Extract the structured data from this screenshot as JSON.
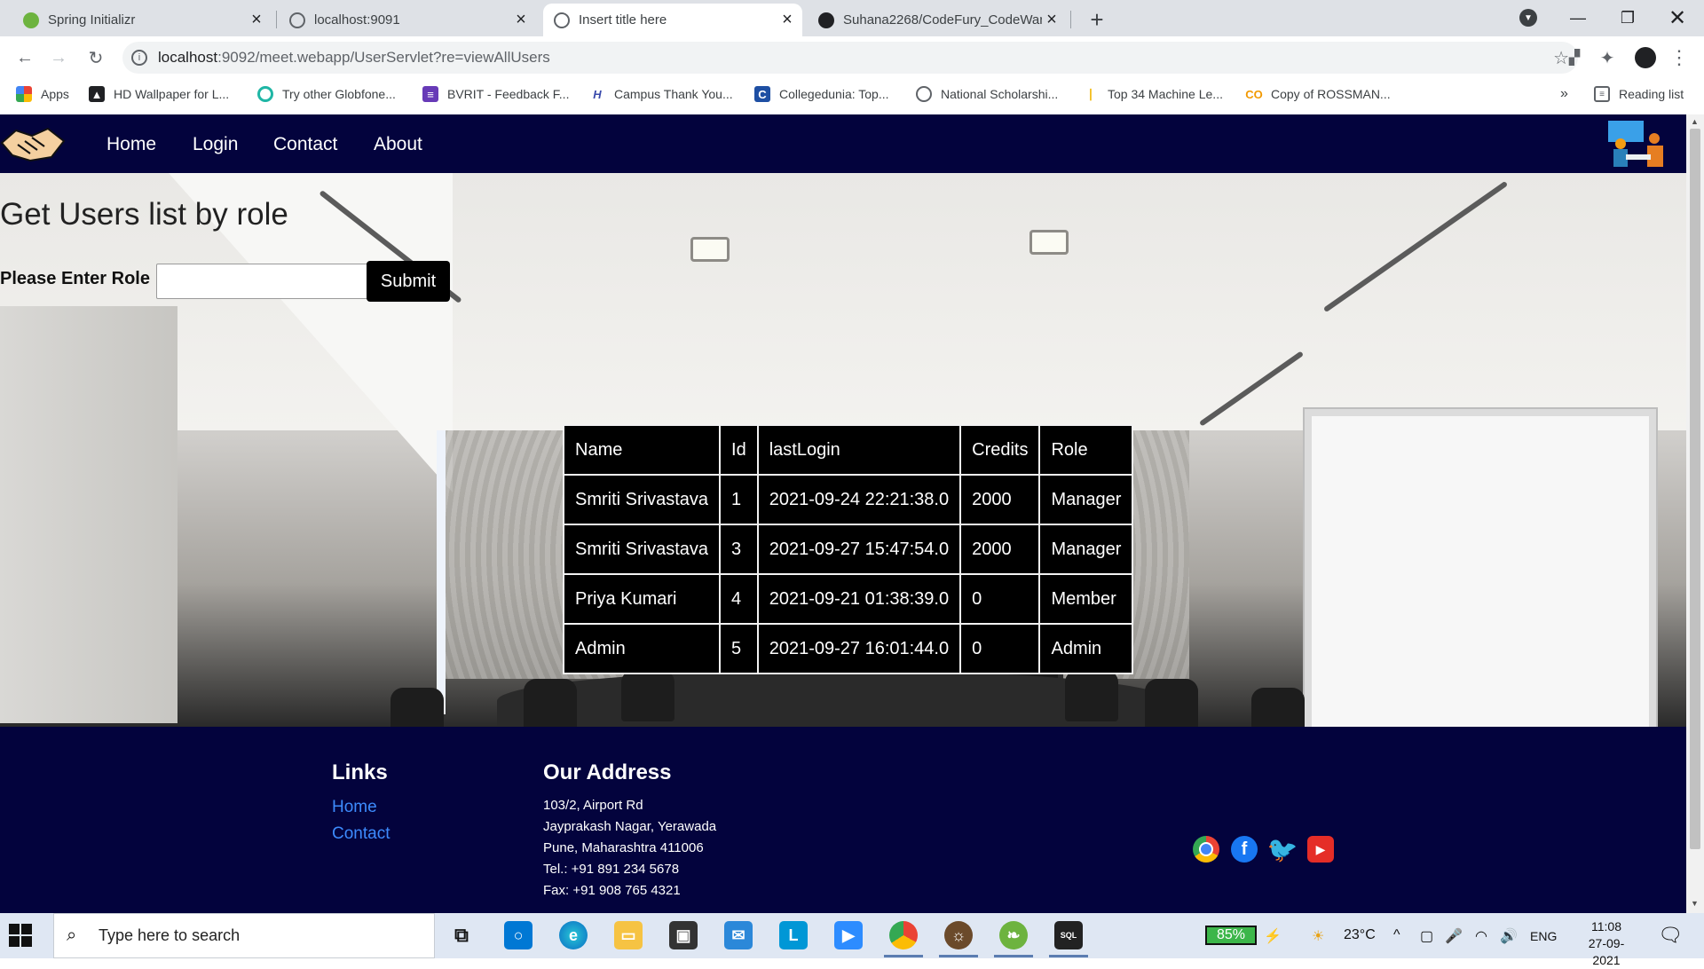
{
  "browser": {
    "tabs": [
      {
        "title": "Spring Initializr",
        "favicon_color": "#6db33f",
        "active": false
      },
      {
        "title": "localhost:9091",
        "favicon_color": "#5f6368",
        "active": false
      },
      {
        "title": "Insert title here",
        "favicon_color": "#5f6368",
        "active": true
      },
      {
        "title": "Suhana2268/CodeFury_CodeWar",
        "favicon_color": "#202124",
        "active": false
      }
    ],
    "new_tab": "+",
    "address": {
      "host": "localhost",
      "rest": ":9092/meet.webapp/UserServlet?re=viewAllUsers"
    },
    "bookmarks": [
      {
        "label": "Apps"
      },
      {
        "label": "HD Wallpaper for L..."
      },
      {
        "label": "Try other Globfone..."
      },
      {
        "label": "BVRIT - Feedback F..."
      },
      {
        "label": "Campus Thank You..."
      },
      {
        "label": "Collegedunia: Top..."
      },
      {
        "label": "National Scholarshi..."
      },
      {
        "label": "Top 34 Machine Le..."
      },
      {
        "label": "Copy of ROSSMAN..."
      }
    ],
    "bookmarks_overflow": "»",
    "reading_list": "Reading list"
  },
  "page": {
    "nav": {
      "links": [
        "Home",
        "Login",
        "Contact",
        "About"
      ]
    },
    "heading": "Get Users list by role",
    "role_label": "Please Enter Role",
    "role_value": "",
    "submit_label": "Submit",
    "table": {
      "headers": [
        "Name",
        "Id",
        "lastLogin",
        "Credits",
        "Role"
      ],
      "rows": [
        [
          "Smriti Srivastava",
          "1",
          "2021-09-24 22:21:38.0",
          "2000",
          "Manager"
        ],
        [
          "Smriti Srivastava",
          "3",
          "2021-09-27 15:47:54.0",
          "2000",
          "Manager"
        ],
        [
          "Priya Kumari",
          "4",
          "2021-09-21 01:38:39.0",
          "0",
          "Member"
        ],
        [
          "Admin",
          "5",
          "2021-09-27 16:01:44.0",
          "0",
          "Admin"
        ]
      ]
    },
    "footer": {
      "links_title": "Links",
      "links": [
        "Home",
        "Contact"
      ],
      "address_title": "Our Address",
      "address_lines": [
        "103/2, Airport Rd",
        "Jayprakash Nagar, Yerawada",
        "Pune, Maharashtra 411006",
        "Tel.: +91 891 234 5678",
        "Fax: +91 908 765 4321"
      ],
      "social": [
        "google-icon",
        "facebook-icon",
        "twitter-icon",
        "youtube-icon"
      ]
    }
  },
  "taskbar": {
    "search_placeholder": "Type here to search",
    "battery": "85%",
    "temperature": "23°C",
    "language": "ENG",
    "time": "11:08",
    "date": "27-09-2021"
  },
  "colors": {
    "navbar": "#03033d",
    "link": "#3d8bfd",
    "table_bg": "#000000"
  }
}
